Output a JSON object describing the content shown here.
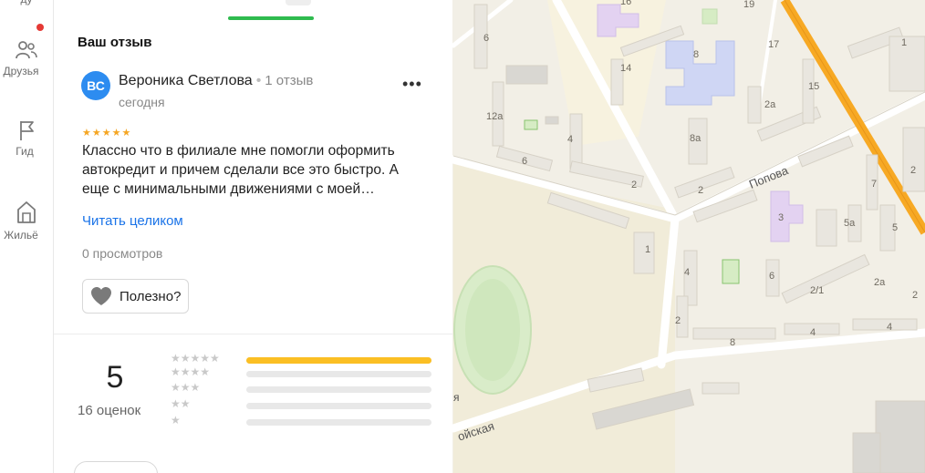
{
  "rail": {
    "items": [
      {
        "label": "Друзья",
        "icon": "friends-icon"
      },
      {
        "label": "Гид",
        "icon": "flag-icon"
      },
      {
        "label": "Жильё",
        "icon": "house-icon"
      }
    ],
    "top_label_fragment": "ду"
  },
  "review": {
    "section_title": "Ваш отзыв",
    "author_initials": "ВС",
    "author_name": "Вероника Светлова",
    "author_reviews": "1 отзыв",
    "date": "сегодня",
    "stars": "★★★★★",
    "text": "Классно что в филиале мне помогли оформить автокредит и причем сделали все это быстро. А еще с минимальными движениями с моей…",
    "read_more": "Читать целиком",
    "views": "0 просмотров",
    "helpful_label": "Полезно?"
  },
  "rating": {
    "score": "5",
    "count_label": "16 оценок",
    "rows": [
      {
        "stars": "★★★★★",
        "fraction": 1.0
      },
      {
        "stars": "★★★★",
        "fraction": 0
      },
      {
        "stars": "★★★",
        "fraction": 0
      },
      {
        "stars": "★★",
        "fraction": 0
      },
      {
        "stars": "★",
        "fraction": 0
      }
    ]
  },
  "map": {
    "streets": [
      "Попова",
      "ойская",
      "я"
    ],
    "house_numbers": [
      "16",
      "19",
      "17",
      "15",
      "1",
      "8",
      "14",
      "2a",
      "8a",
      "12a",
      "6",
      "4",
      "6",
      "2",
      "2",
      "3",
      "5a",
      "7",
      "5",
      "1",
      "4",
      "6",
      "2/1",
      "2a",
      "2",
      "8",
      "4",
      "4",
      "2",
      "2"
    ]
  },
  "colors": {
    "accent_green": "#2fbb4f",
    "link_blue": "#1a73e8",
    "star_gold": "#f5a623",
    "bar_gold": "#fbbf24",
    "avatar_blue": "#2d8cf0",
    "notification_red": "#e53935",
    "road_orange": "#f7a924"
  }
}
